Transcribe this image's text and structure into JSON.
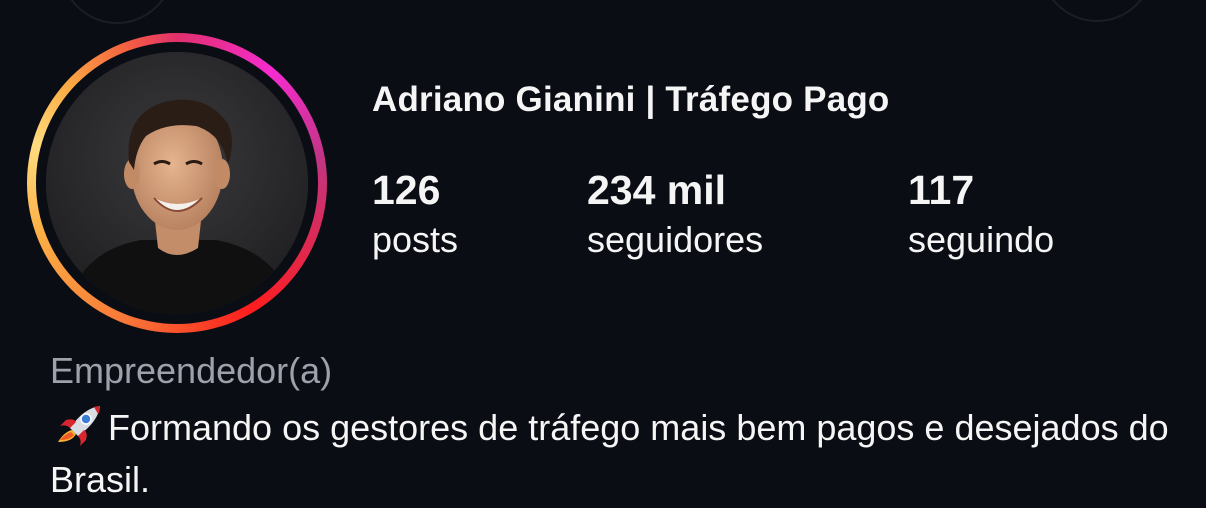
{
  "profile": {
    "name": "Adriano Gianini | Tráfego Pago",
    "avatar_icon": "profile-photo",
    "stats": {
      "posts_count": "126",
      "posts_label": "posts",
      "followers_count": "234 mil",
      "followers_label": "seguidores",
      "following_count": "117",
      "following_label": "seguindo"
    },
    "category": "Empreendedor(a)",
    "bio_icon": "rocket-icon",
    "bio_text": "Formando os gestores de tráfego mais bem pagos e desejados do Brasil."
  },
  "colors": {
    "background": "#0b0d14",
    "text": "#f5f5f5",
    "muted": "#9ea1ab",
    "ring_pink": "#e1306c",
    "ring_orange": "#f77737",
    "ring_yellow": "#fcaf45"
  }
}
